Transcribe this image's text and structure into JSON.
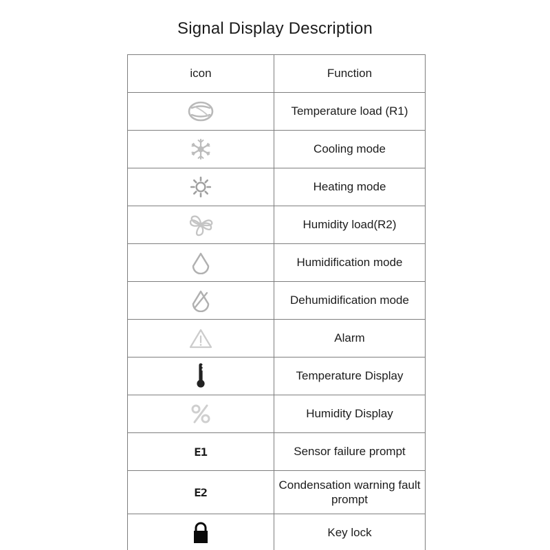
{
  "page": {
    "title": "Signal Display Description",
    "background_color": "#ffffff",
    "text_color": "#1c1c1c",
    "border_color": "#7d7d7d"
  },
  "table": {
    "headers": {
      "icon_column": "icon",
      "function_column": "Function"
    },
    "rows": [
      {
        "icon_name": "temperature-load-coil-icon",
        "icon_kind": "coil-oval",
        "icon_color": "#b9b9b9",
        "function": "Temperature load (R1)"
      },
      {
        "icon_name": "snowflake-icon",
        "icon_kind": "snowflake",
        "icon_color": "#c0c0c0",
        "function": "Cooling mode"
      },
      {
        "icon_name": "sun-icon",
        "icon_kind": "sun",
        "icon_color": "#a8a8a8",
        "function": "Heating mode"
      },
      {
        "icon_name": "fan-icon",
        "icon_kind": "fan",
        "icon_color": "#c4c4c4",
        "function": "Humidity load(R2)"
      },
      {
        "icon_name": "water-drop-icon",
        "icon_kind": "drop",
        "icon_color": "#b0b0b0",
        "function": "Humidification mode"
      },
      {
        "icon_name": "water-drop-slash-icon",
        "icon_kind": "drop-slash",
        "icon_color": "#b0b0b0",
        "function": "Dehumidification mode"
      },
      {
        "icon_name": "warning-triangle-icon",
        "icon_kind": "triangle-alert",
        "icon_color": "#cccccc",
        "function": "Alarm"
      },
      {
        "icon_name": "thermometer-icon",
        "icon_kind": "thermometer",
        "icon_color": "#222222",
        "function": "Temperature Display"
      },
      {
        "icon_name": "percent-icon",
        "icon_kind": "percent",
        "icon_color": "#cfcfcf",
        "function": "Humidity Display"
      },
      {
        "icon_name": "error-code-e1-icon",
        "icon_kind": "text",
        "icon_text": "E1",
        "icon_color": "#1a1a1a",
        "function": "Sensor failure prompt"
      },
      {
        "icon_name": "error-code-e2-icon",
        "icon_kind": "text",
        "icon_text": "E2",
        "icon_color": "#1a1a1a",
        "function": "Condensation warning fault prompt"
      },
      {
        "icon_name": "padlock-icon",
        "icon_kind": "lock",
        "icon_color": "#0a0a0a",
        "function": "Key lock"
      }
    ]
  }
}
